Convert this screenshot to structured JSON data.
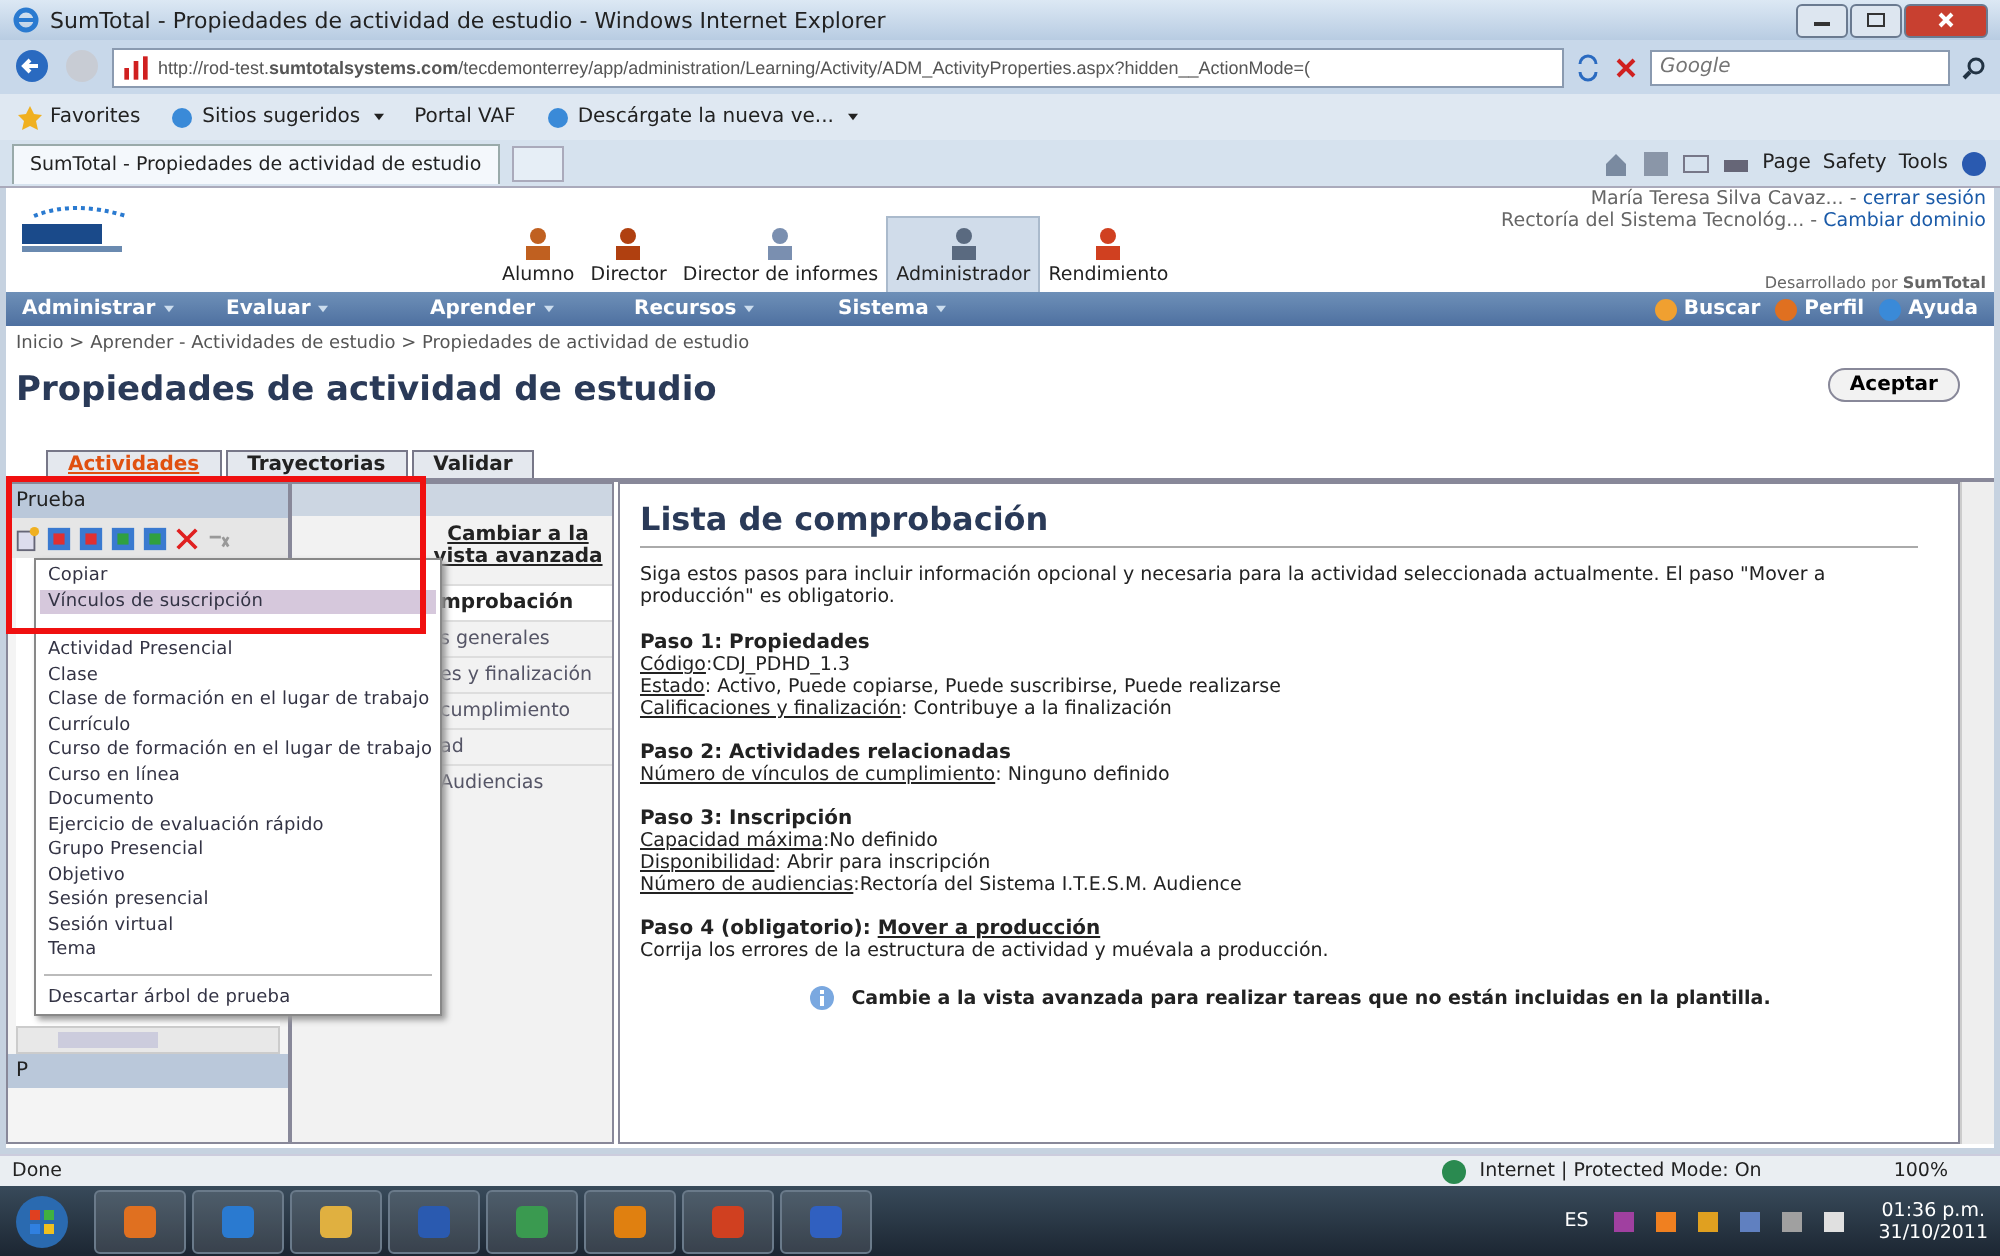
{
  "window": {
    "title": "SumTotal - Propiedades de actividad de estudio - Windows Internet Explorer"
  },
  "address_bar": {
    "url": "http://rod-test.**sumtotalsystems.com**/tecdemonterrey/app/administration/Learning/Activity/ADM_ActivityProperties.aspx?hidden__ActionMode=(",
    "search_placeholder": "Google"
  },
  "favorites_bar": {
    "items": [
      {
        "label": "Favorites",
        "kind": "star"
      },
      {
        "label": "Sitios sugeridos",
        "kind": "menu"
      },
      {
        "label": "Portal VAF",
        "kind": "plain"
      },
      {
        "label": "Descárgate la nueva ve...",
        "kind": "menu"
      }
    ]
  },
  "browser_tab": {
    "title": "SumTotal - Propiedades de actividad de estudio"
  },
  "command_bar": [
    "Page",
    "Safety",
    "Tools"
  ],
  "site_header": {
    "user_name": "María Teresa Silva Cavaz... -",
    "logout": "cerrar sesión",
    "organization": "Rectoría del Sistema Tecnológ... -",
    "change_domain": "Cambiar dominio",
    "powered_by": "Desarrollado por **SumTotal**",
    "roles": [
      {
        "label": "Alumno",
        "selected": false
      },
      {
        "label": "Director",
        "selected": false
      },
      {
        "label": "Director de informes",
        "selected": false
      },
      {
        "label": "Administrador",
        "selected": true
      },
      {
        "label": "Rendimiento",
        "selected": false
      }
    ]
  },
  "menu_bar": {
    "items": [
      "Administrar",
      "Evaluar",
      "Aprender",
      "Recursos",
      "Sistema"
    ],
    "tools": [
      "Buscar",
      "Perfil",
      "Ayuda"
    ]
  },
  "breadcrumb": "Inicio > Aprender - Actividades de estudio > Propiedades de actividad de estudio",
  "page_title": "Propiedades de actividad de estudio",
  "accept_button": "Aceptar",
  "tabs": [
    {
      "label": "Actividades",
      "selected": true
    },
    {
      "label": "Trayectorias",
      "selected": false
    },
    {
      "label": "Validar",
      "selected": false
    }
  ],
  "tree_panel": {
    "title": "Prueba",
    "lower_title": "P"
  },
  "context_menu": {
    "top_items": [
      {
        "label": "Copiar",
        "selected": false
      },
      {
        "label": "Vínculos de suscripción",
        "selected": true
      }
    ],
    "add_items": [
      "Actividad Presencial",
      "Clase",
      "Clase de formación en el lugar de trabajo",
      "Currículo",
      "Curso de formación en el lugar de trabajo",
      "Curso en línea",
      "Documento",
      "Ejercicio de evaluación rápido",
      "Grupo Presencial",
      "Objetivo",
      "Sesión presencial",
      "Sesión virtual",
      "Tema"
    ],
    "bottom_item": "Descartar árbol de prueba"
  },
  "side_nav": {
    "heading": "Cambiar a la vista avanzada",
    "items": [
      {
        "label": "mprobación",
        "selected": true
      },
      {
        "label": "s generales",
        "selected": false
      },
      {
        "label": "es y finalización",
        "selected": false
      },
      {
        "label": "cumplimiento",
        "selected": false
      },
      {
        "label": "ad",
        "selected": false
      },
      {
        "label": "Audiencias",
        "selected": false
      }
    ]
  },
  "checklist": {
    "title": "Lista de comprobación",
    "intro": "Siga estos pasos para incluir información opcional y necesaria para la actividad seleccionada actualmente. El paso \"Mover a producción\" es obligatorio.",
    "steps": [
      {
        "heading": "Paso 1: Propiedades",
        "lines": [
          {
            "label": "Código",
            "value": ":CDJ_PDHD_1.3"
          },
          {
            "label": "Estado",
            "value": ": Activo, Puede copiarse, Puede suscribirse, Puede realizarse"
          },
          {
            "label": "Calificaciones y finalización",
            "value": ": Contribuye a la finalización"
          }
        ]
      },
      {
        "heading": "Paso 2: Actividades relacionadas",
        "lines": [
          {
            "label": "Número de vínculos de cumplimiento",
            "value": ": Ninguno definido"
          }
        ]
      },
      {
        "heading": "Paso 3: Inscripción",
        "lines": [
          {
            "label": "Capacidad máxima",
            "value": ":No definido"
          },
          {
            "label": "Disponibilidad",
            "value": ": Abrir para inscripción"
          },
          {
            "label": "Número de audiencias",
            "value": ":Rectoría del Sistema I.T.E.S.M. Audience"
          }
        ]
      },
      {
        "heading": "Paso 4 (obligatorio): ",
        "link": "Mover a producción",
        "note": "Corrija los errores de la estructura de actividad y muévala a producción."
      }
    ],
    "tip": "Cambie a la vista avanzada para realizar tareas que no están incluidas en la plantilla."
  },
  "status_bar": {
    "status": "Done",
    "zone": "Internet | Protected Mode: On",
    "zoom": "100%"
  },
  "taskbar": {
    "language": "ES",
    "time": "01:36 p.m.",
    "date": "31/10/2011"
  }
}
